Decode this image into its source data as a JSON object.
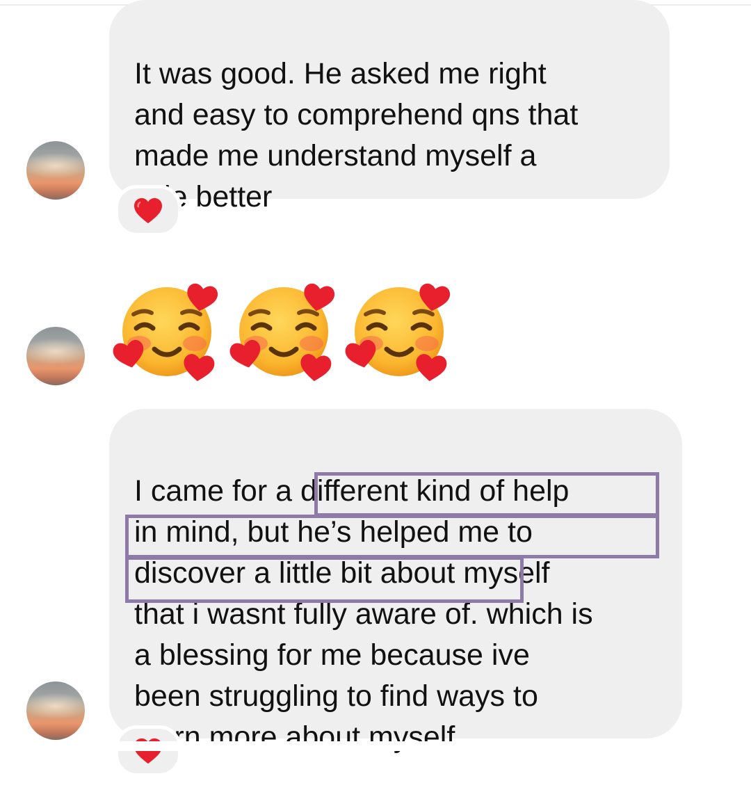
{
  "messages": [
    {
      "text": "It was good. He asked me right\nand easy to comprehend qns that\nmade me understand myself a\nlittle better",
      "reaction": "red-heart"
    },
    {
      "emojis": [
        "smiling-face-with-hearts",
        "smiling-face-with-hearts",
        "smiling-face-with-hearts"
      ]
    },
    {
      "text": "I came for a different kind of help\nin mind, but he’s helped me to\ndiscover a little bit about myself\nthat i wasnt fully aware of. which is\na blessing for me because ive\nbeen struggling to find ways to\nlearn more about myself",
      "reaction": "red-heart",
      "highlight": "he’s helped me to discover a little bit about myself that i wasnt fully aware of."
    }
  ],
  "colors": {
    "bubble": "#efefef",
    "text": "#111111",
    "highlight_border": "#8d7aa6",
    "heart": "#e8202e",
    "emoji_face": "#fbb730"
  }
}
